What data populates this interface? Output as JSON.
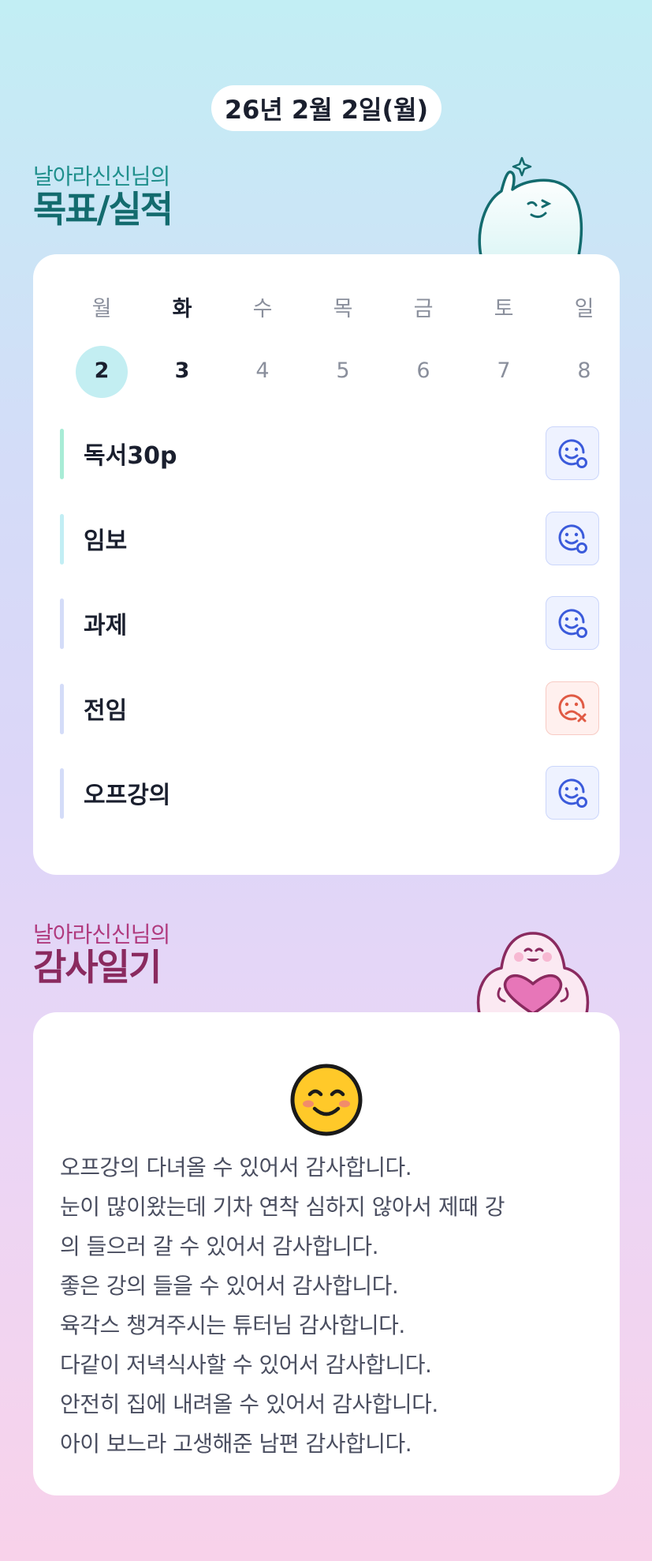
{
  "header": {
    "date": "26년 2월 2일(월)"
  },
  "goals_section": {
    "subtitle": "날아라신신님의",
    "title": "목표/실적"
  },
  "week": {
    "days": [
      {
        "dow": "월",
        "date": "2"
      },
      {
        "dow": "화",
        "date": "3"
      },
      {
        "dow": "수",
        "date": "4"
      },
      {
        "dow": "목",
        "date": "5"
      },
      {
        "dow": "금",
        "date": "6"
      },
      {
        "dow": "토",
        "date": "7"
      },
      {
        "dow": "일",
        "date": "8"
      }
    ],
    "selected_index": 0
  },
  "goals": [
    {
      "label": "독서30p",
      "status": "done",
      "icon": "smile-check-icon",
      "bar_color": "#a8ecd6"
    },
    {
      "label": "임보",
      "status": "done",
      "icon": "smile-check-icon",
      "bar_color": "#c2eef4"
    },
    {
      "label": "과제",
      "status": "done",
      "icon": "smile-check-icon",
      "bar_color": "#d4dcf8"
    },
    {
      "label": "전임",
      "status": "failed",
      "icon": "sad-x-icon",
      "bar_color": "#d4dcf8"
    },
    {
      "label": "오프강의",
      "status": "done",
      "icon": "smile-check-icon",
      "bar_color": "#d4dcf8"
    }
  ],
  "thanks_section": {
    "subtitle": "날아라신신님의",
    "title": "감사일기"
  },
  "diary": {
    "mood_icon": "smiling-face-emoji",
    "lines": [
      "오프강의 다녀올 수 있어서 감사합니다.",
      "눈이 많이왔는데 기차 연착 심하지 않아서 제때 강",
      "의 들으러 갈 수 있어서 감사합니다.",
      "좋은 강의  들을 수 있어서 감사합니다.",
      "육각스 챙겨주시는 튜터님 감사합니다.",
      "다같이 저녁식사할 수 있어서 감사합니다.",
      "안전히 집에 내려올 수 있어서 감사합니다.",
      "아이 보느라 고생해준 남편 감사합니다."
    ]
  },
  "colors": {
    "ok_icon": "#3b5bdb",
    "fail_icon": "#e05a44",
    "selected_date_bg": "#c3eef2"
  }
}
